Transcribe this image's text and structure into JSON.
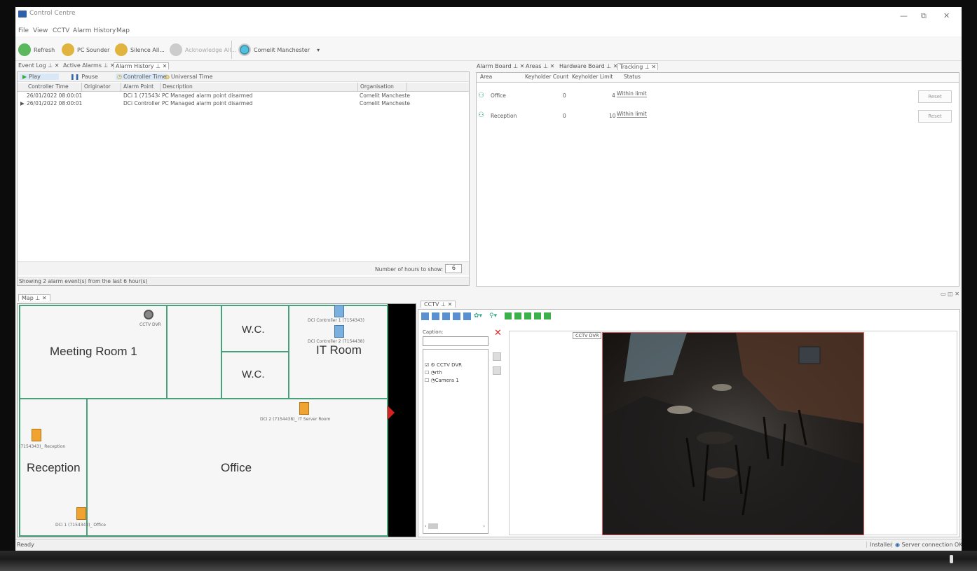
{
  "window": {
    "title": "Control Centre",
    "minimize": "—",
    "restore": "⧉",
    "close": "✕"
  },
  "menu": [
    "File",
    "View",
    "CCTV",
    "Alarm History",
    "Map"
  ],
  "toolbar": {
    "refresh": "Refresh",
    "pc_sounder": "PC Sounder",
    "silence_all": "Silence All...",
    "acknowledge_all": "Acknowledge All...",
    "site": "Comelit Manchester",
    "dropdown_glyph": "▾"
  },
  "left_tabs": [
    "Event Log ⊥ ✕",
    "Active Alarms ⊥ ✕",
    "Alarm History ⊥ ✕"
  ],
  "alarm_history": {
    "play": "Play",
    "pause": "Pause",
    "controller_time": "Controller Time",
    "universal_time": "Universal Time",
    "columns": [
      "Controller Time",
      "Originator",
      "Alarm Point",
      "Description",
      "Organisation"
    ],
    "rows": [
      [
        "26/01/2022 08:00:01",
        "",
        "DCi 1 (715434",
        "PC Managed alarm point disarmed",
        "Comelit Mancheste"
      ],
      [
        "26/01/2022 08:00:01",
        "",
        "DCi Controller",
        "PC Managed alarm point disarmed",
        "Comelit Mancheste"
      ]
    ],
    "hours_label": "Number of hours to show:",
    "hours_value": "6",
    "footer": "Showing 2 alarm event(s) from the last 6 hour(s)"
  },
  "right_tabs": [
    "Alarm Board ⊥ ✕",
    "Areas ⊥ ✕",
    "Hardware Board ⊥ ✕",
    "Tracking ⊥ ✕"
  ],
  "tracking": {
    "columns": [
      "Area",
      "Keyholder Count",
      "Keyholder Limit",
      "Status"
    ],
    "rows": [
      {
        "area": "Office",
        "count": "0",
        "limit": "4",
        "status": "Within limit",
        "reset": "Reset"
      },
      {
        "area": "Reception",
        "count": "0",
        "limit": "10",
        "status": "Within limit",
        "reset": "Reset"
      }
    ]
  },
  "map": {
    "tab": "Map ⊥ ✕",
    "rooms": {
      "meeting": "Meeting Room 1",
      "wc1": "W.C.",
      "wc2": "W.C.",
      "it": "IT Room",
      "reception": "Reception",
      "office": "Office"
    },
    "devices": {
      "cctv": "CCTV DVR",
      "dc1": "DCi Controller 1 (7154343)",
      "dc2": "DCi Controller 2 (7154438)",
      "server": "DCi 2 (7154438)_ IT Server Room",
      "reception": "(7154343)_ Reception",
      "office": "DCi 1 (7154343)_ Office"
    }
  },
  "cctv": {
    "tab": "CCTV ⊥ ✕",
    "caption_label": "Caption:",
    "tree": [
      "CCTV DVR",
      "rth",
      "Camera 1"
    ],
    "video_label": "CCTV DVR",
    "panel_controls": "▭ ◫ ✕"
  },
  "status": {
    "left": "Ready",
    "user": "Installer",
    "server": "Server connection OK"
  },
  "colors": {
    "wall": "#4aa07a",
    "video_border": "#e06060",
    "reset_x": "#dd2222"
  }
}
